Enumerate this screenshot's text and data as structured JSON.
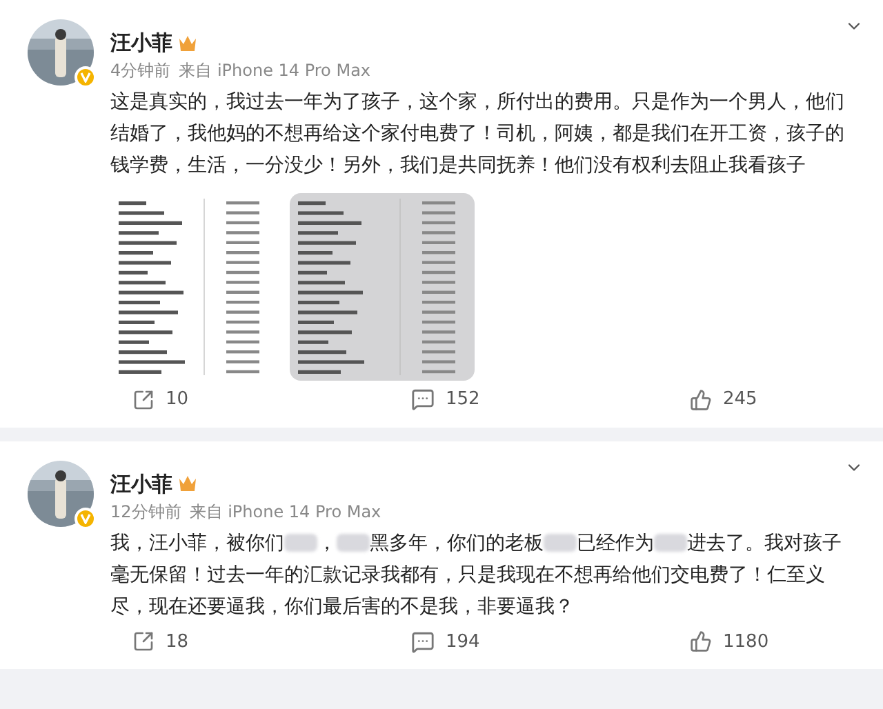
{
  "posts": [
    {
      "author": "汪小菲",
      "time": "4分钟前",
      "source": "来自 iPhone 14 Pro Max",
      "verified": true,
      "segments": [
        {
          "kind": "text",
          "text": "这是真实的，我过去一年为了孩子，这个家，所付出的费用。只是作为一个男人，他们结婚了，我他妈的不想再给这个家付电费了！司机，阿姨，都是我们在开工资，孩子的钱学费，生活，一分没少！另外，我们是共同抚养！他们没有权利去阻止我看孩子"
        }
      ],
      "images": [
        {
          "kind": "picture"
        },
        {
          "kind": "picture"
        }
      ],
      "reposts": "10",
      "comments": "152",
      "likes": "245"
    },
    {
      "author": "汪小菲",
      "time": "12分钟前",
      "source": "来自 iPhone 14 Pro Max",
      "verified": true,
      "segments": [
        {
          "kind": "text",
          "text": "我，汪小菲，被你们"
        },
        {
          "kind": "blurred"
        },
        {
          "kind": "text",
          "text": "，"
        },
        {
          "kind": "blurred"
        },
        {
          "kind": "text",
          "text": "黑多年，你们的老板"
        },
        {
          "kind": "blurred"
        },
        {
          "kind": "text",
          "text": "已经作为"
        },
        {
          "kind": "blurred"
        },
        {
          "kind": "text",
          "text": "进去了。我对孩子毫无保留！过去一年的汇款记录我都有，只是我现在不想再给他们交电费了！仁至义尽，现在还要逼我，你们最后害的不是我，非要逼我？"
        }
      ],
      "reposts": "18",
      "comments": "194",
      "likes": "1180"
    }
  ]
}
